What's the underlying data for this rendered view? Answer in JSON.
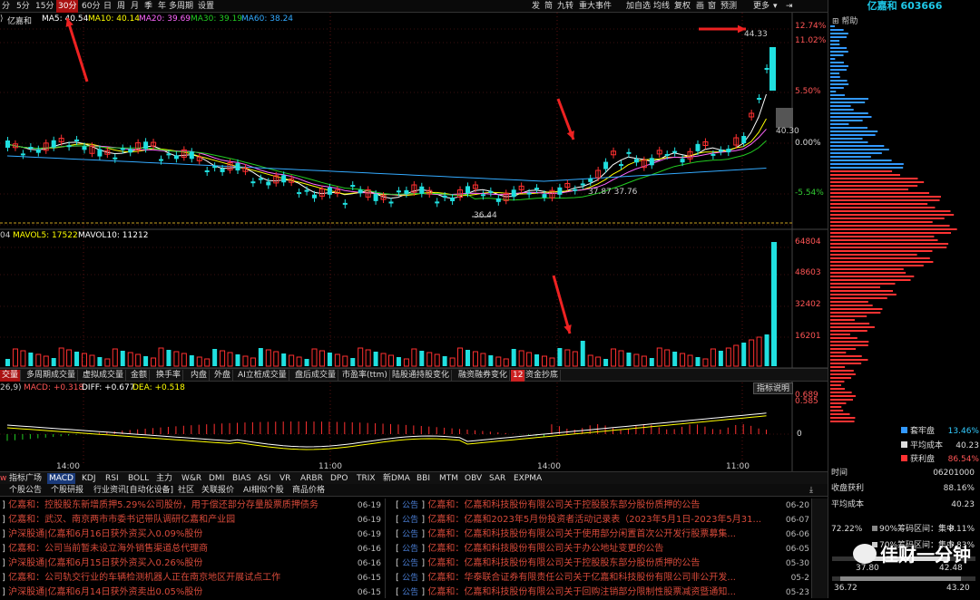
{
  "topbar": {
    "periods": [
      "分",
      "5分",
      "15分",
      "30分",
      "60分",
      "日",
      "周",
      "月",
      "季",
      "年",
      "多周期",
      "设置"
    ],
    "active_period": "30分",
    "right_tools": [
      "发",
      "简",
      "九转",
      "重大事件",
      "加自选",
      "均线",
      "复权",
      "画",
      "窗",
      "预测",
      "更多"
    ]
  },
  "ma_legend": {
    "stock": "亿嘉和",
    "ma5": "MA5: 40.54",
    "ma10": "MA10: 40.14",
    "ma20": "MA20: 39.69",
    "ma30": "MA30: 39.19",
    "ma60": "MA60: 38.24",
    "colors": {
      "ma5": "#ffffff",
      "ma10": "#ffff00",
      "ma20": "#ff66ff",
      "ma30": "#22cc22",
      "ma60": "#33aaff"
    }
  },
  "price_axis": [
    "12.74%",
    "11.02%",
    "5.50%",
    "0.00%",
    "-5.54%"
  ],
  "price_annotations": {
    "high": "44.33",
    "last": "40.30",
    "low": "36.44",
    "mid": "37.87 37.76"
  },
  "chart_data": {
    "type": "candlestick",
    "y_label_pct": [
      "12.74%",
      "11.02%",
      "5.50%",
      "0.00%",
      "-5.54%"
    ],
    "high_marker": 44.33,
    "low_marker": 36.44,
    "volume_axis": [
      64804,
      48603,
      32402,
      16201
    ],
    "volume_legend": {
      "mavol5": "MAVOL5: 17522",
      "mavol10": "MAVOL10: 11212"
    },
    "macd_legend": {
      "macd": "MACD: +0.318",
      "diff": "DIFF: +0.677",
      "dea": "DEA: +0.518"
    },
    "macd_axis": [
      "0.689",
      "0.585",
      "0"
    ],
    "time_labels": [
      "14:00",
      "11:00",
      "14:00",
      "11:00"
    ]
  },
  "volume": {
    "legend_prefix": "04",
    "mavol5": "MAVOL5: 17522",
    "mavol10": "MAVOL10: 11212",
    "axis": [
      "64804",
      "48603",
      "32402",
      "16201"
    ]
  },
  "vol_tabs": [
    "交量",
    "多周期成交量",
    "虚拟成交量",
    "金额",
    "换手率",
    "内盘",
    "外盘",
    "AI立桩成交量",
    "盘后成交量",
    "市盈率(ttm)",
    "陆股通持股变化",
    "融资融券变化",
    "资金抄底"
  ],
  "vol_badge": "12",
  "macd": {
    "params": "26,9)",
    "macd": "MACD: +0.318",
    "diff": "DIFF: +0.677",
    "dea": "DEA: +0.518",
    "axis": [
      "0.689",
      "0.585",
      "0"
    ],
    "help": "指标说明"
  },
  "time_axis": [
    "14:00",
    "11:00",
    "14:00",
    "11:00"
  ],
  "ind_tabs": [
    "指标广场",
    "MACD",
    "KDJ",
    "RSI",
    "BOLL",
    "主力",
    "W&R",
    "DMI",
    "BIAS",
    "ASI",
    "VR",
    "ARBR",
    "DPO",
    "TRIX",
    "新DMA",
    "BBI",
    "MTM",
    "OBV",
    "SAR",
    "EXPMA"
  ],
  "ind_prefix": "w",
  "news_tabs": [
    "个股公告",
    "个股研报",
    "行业资讯[自动化设备]",
    "社区",
    "关联报价",
    "AI相似个股",
    "商品价格"
  ],
  "news_left": [
    {
      "text": "亿嘉和：控股股东新增质押5.29%公司股份，用于偿还部分存量股票质押债务",
      "date": "06-19"
    },
    {
      "text": "亿嘉和：武汉、南京两市市委书记带队调研亿嘉和产业园",
      "date": "06-19"
    },
    {
      "text": "沪深股通|亿嘉和6月16日获外资买入0.09%股份",
      "date": "06-19"
    },
    {
      "text": "亿嘉和：公司当前暂未设立海外销售渠道总代理商",
      "date": "06-16"
    },
    {
      "text": "沪深股通|亿嘉和6月15日获外资买入0.26%股份",
      "date": "06-16"
    },
    {
      "text": "亿嘉和：公司轨交行业的车辆检测机器人正在南京地区开展试点工作",
      "date": "06-15"
    },
    {
      "text": "沪深股通|亿嘉和6月14日获外资卖出0.05%股份",
      "date": "06-15"
    }
  ],
  "news_right": [
    {
      "tag": "公告",
      "text": "亿嘉和：亿嘉和科技股份有限公司关于控股股东部分股份质押的公告",
      "date": "06-20"
    },
    {
      "tag": "公告",
      "text": "亿嘉和：亿嘉和2023年5月份投资者活动记录表（2023年5月1日-2023年5月31...",
      "date": "06-07"
    },
    {
      "tag": "公告",
      "text": "亿嘉和：亿嘉和科技股份有限公司关于使用部分闲置首次公开发行股票募集...",
      "date": "06-06"
    },
    {
      "tag": "公告",
      "text": "亿嘉和：亿嘉和科技股份有限公司关于办公地址变更的公告",
      "date": "06-05"
    },
    {
      "tag": "公告",
      "text": "亿嘉和：亿嘉和科技股份有限公司关于控股股东部分股份质押的公告",
      "date": "05-30"
    },
    {
      "tag": "公告",
      "text": "亿嘉和：华泰联合证券有限责任公司关于亿嘉和科技股份有限公司非公开发...",
      "date": "05-2"
    },
    {
      "tag": "公告",
      "text": "亿嘉和：亿嘉和科技股份有限公司关于回购注销部分限制性股票减资暨通知...",
      "date": "05-23"
    }
  ],
  "right_panel": {
    "title": "亿嘉和 603666",
    "help": "帮助",
    "legend": [
      {
        "label": "套牢盘",
        "value": "13.46%",
        "color": "#3399ff"
      },
      {
        "label": "平均成本",
        "value": "40.23",
        "color": "#dddddd"
      },
      {
        "label": "获利盘",
        "value": "86.54%",
        "color": "#ff3333"
      }
    ],
    "stats": [
      {
        "label": "时间",
        "value": "06201000"
      },
      {
        "label": "收盘获利",
        "value": "88.16%"
      },
      {
        "label": "平均成本",
        "value": "40.23"
      }
    ],
    "conc": {
      "pct": "72.22%",
      "l90": "90%筹码区间：集中",
      "v90": "8.11%",
      "l70": "70%筹码区间：集中",
      "v70": "5.83%"
    },
    "ranges": {
      "r1lo": "37.80",
      "r1hi": "42.48",
      "r2lo": "36.72",
      "r2hi": "43.20"
    }
  },
  "watermark": "佳财一分钟"
}
